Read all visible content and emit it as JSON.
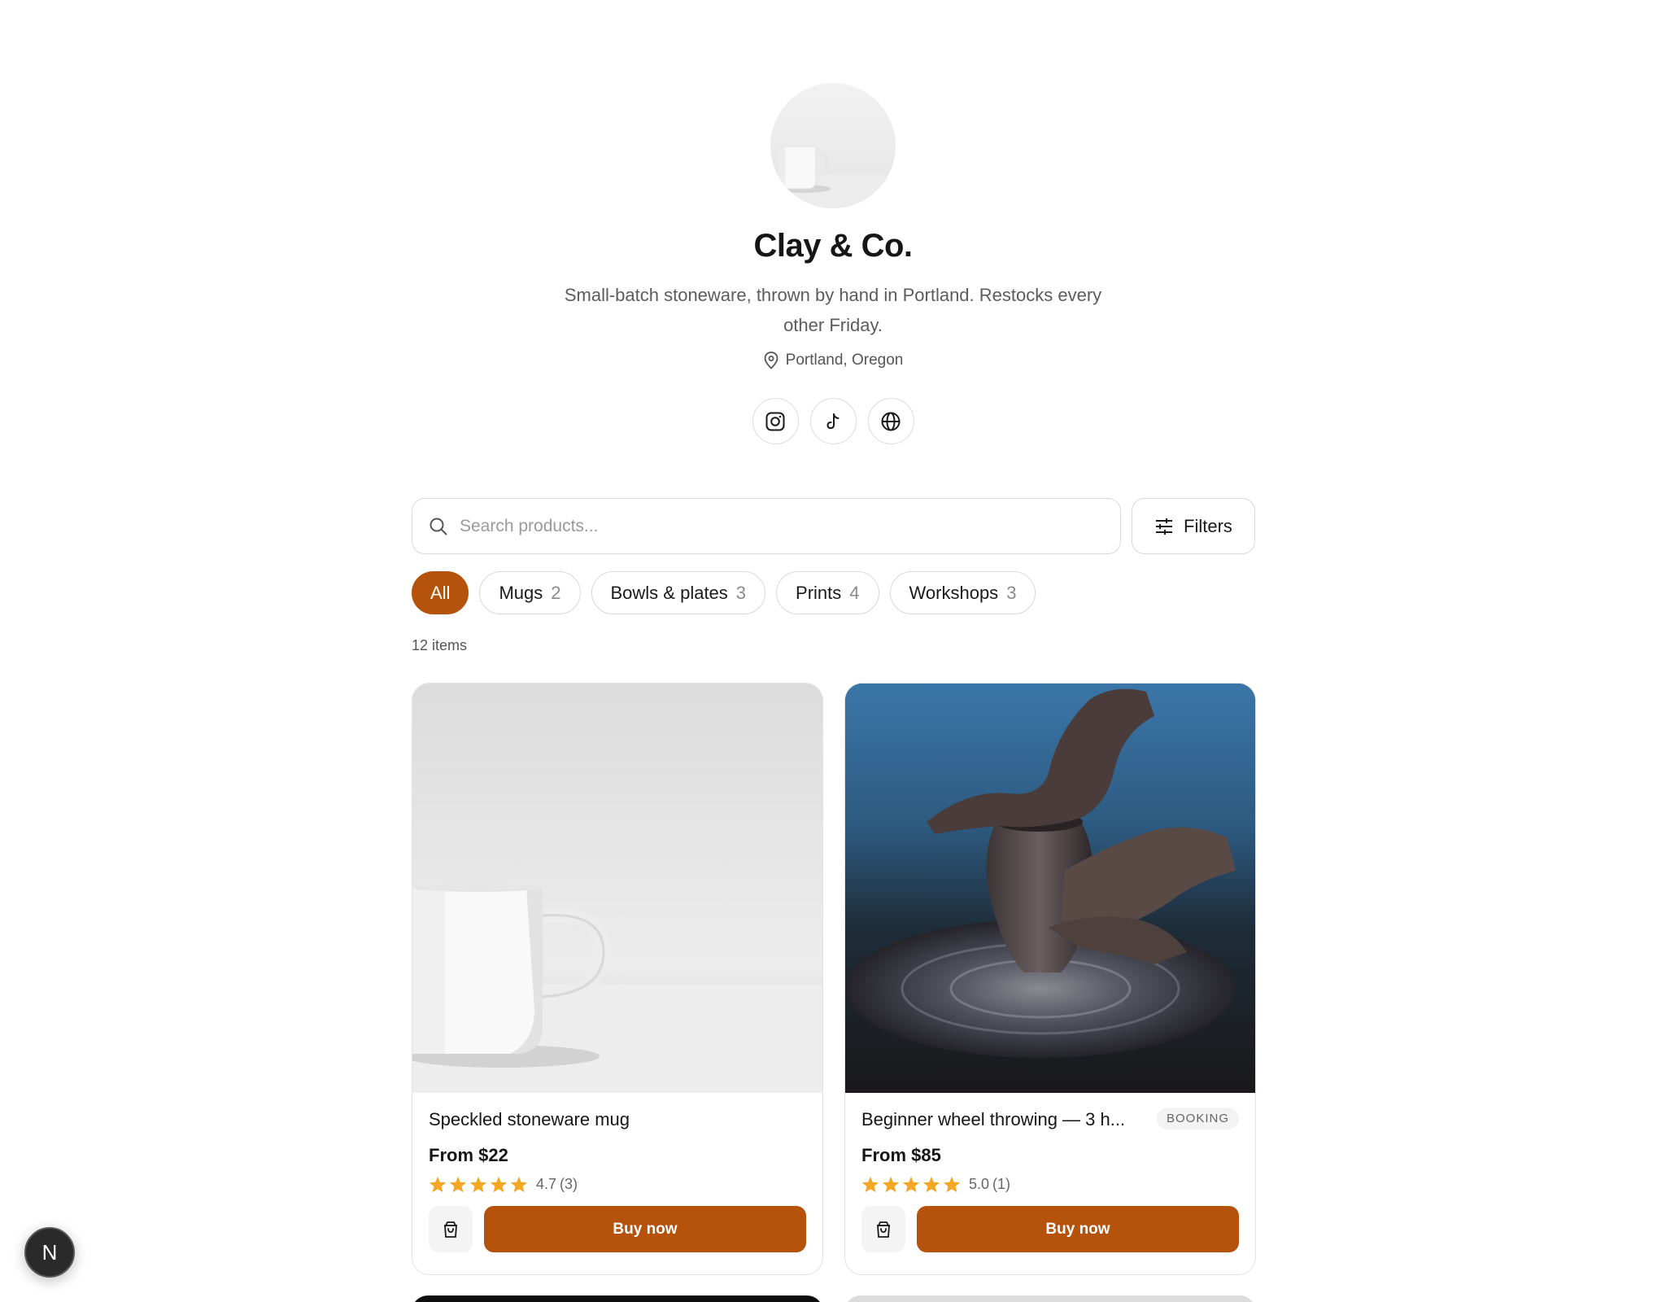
{
  "shop": {
    "name": "Clay & Co.",
    "bio": "Small-batch stoneware, thrown by hand in Portland. Restocks every other Friday.",
    "location": "Portland, Oregon",
    "avatar_icon": "mug-photo",
    "socials": [
      {
        "name": "instagram",
        "icon": "instagram-icon"
      },
      {
        "name": "tiktok",
        "icon": "tiktok-icon"
      },
      {
        "name": "website",
        "icon": "globe-icon"
      }
    ]
  },
  "search": {
    "placeholder": "Search products...",
    "value": ""
  },
  "filters": {
    "label": "Filters"
  },
  "categories": [
    {
      "label": "All",
      "count": "",
      "active": true
    },
    {
      "label": "Mugs",
      "count": "2",
      "active": false
    },
    {
      "label": "Bowls & plates",
      "count": "3",
      "active": false
    },
    {
      "label": "Prints",
      "count": "4",
      "active": false
    },
    {
      "label": "Workshops",
      "count": "3",
      "active": false
    }
  ],
  "results": {
    "count_label": "12 items"
  },
  "products": [
    {
      "title": "Speckled stoneware mug",
      "price": "From $22",
      "rating": "4.7",
      "reviews": "(3)",
      "stars": 5,
      "badge": "",
      "buy_label": "Buy now"
    },
    {
      "title": "Beginner wheel throwing — 3 h...",
      "price": "From $85",
      "rating": "5.0",
      "reviews": "(1)",
      "stars": 5,
      "badge": "BOOKING",
      "buy_label": "Buy now"
    }
  ],
  "dev_badge": {
    "label": "N"
  },
  "colors": {
    "accent": "#b5520c",
    "star": "#f5a623",
    "border": "#d9d9d9"
  }
}
